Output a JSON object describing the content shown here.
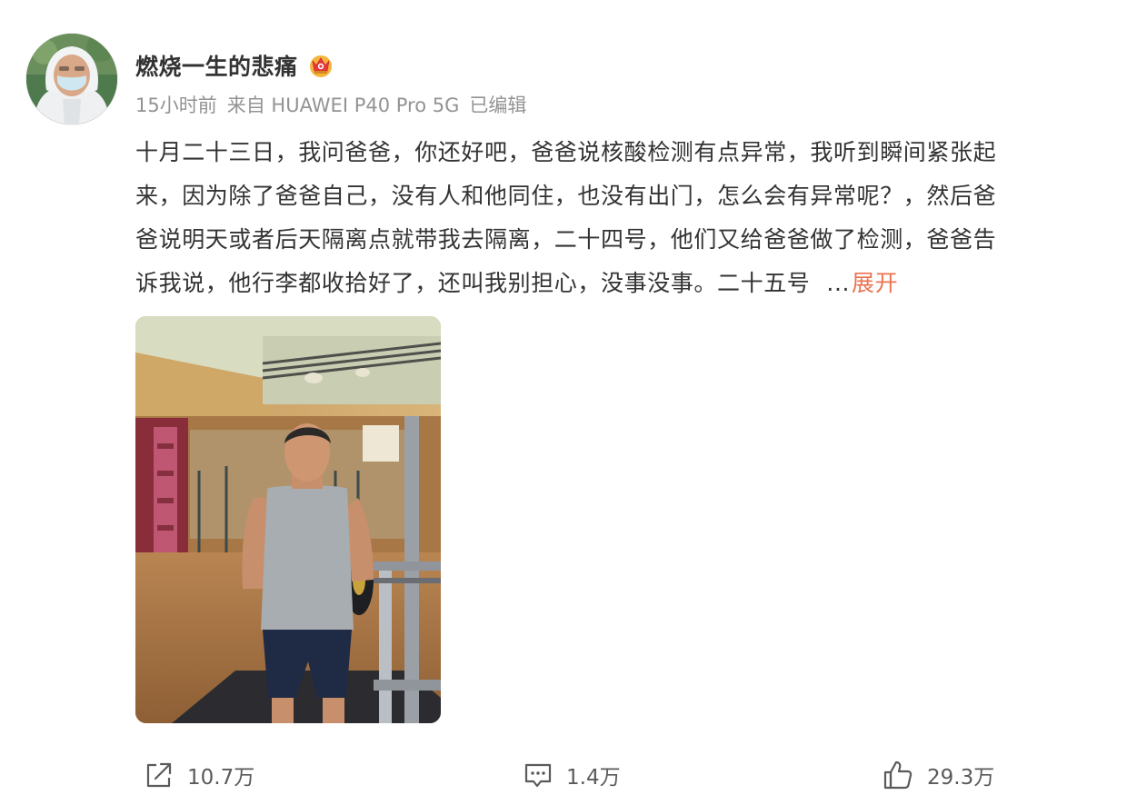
{
  "author": {
    "name": "燃烧一生的悲痛",
    "badge_icon": "vip-crown-badge-icon"
  },
  "meta": {
    "time": "15小时前",
    "source": "来自 HUAWEI P40 Pro 5G",
    "edited": "已编辑"
  },
  "content": {
    "lines": [
      "十月二十三日，我问爸爸，你还好吧，爸爸说核酸检测有点异常，我听到瞬间紧张起",
      "来，因为除了爸爸自己，没有人和他同住，也没有出门，怎么会有异常呢？，然后爸",
      "爸说明天或者后天隔离点就带我去隔离，二十四号，他们又给爸爸做了检测，爸爸告",
      "诉我说，他行李都收拾好了，还叫我别担心，没事没事。二十五号"
    ],
    "ellipsis": "...",
    "expand_label": "展开"
  },
  "actions": {
    "share": {
      "icon": "share-icon",
      "count": "10.7万"
    },
    "comment": {
      "icon": "comment-icon",
      "count": "1.4万"
    },
    "like": {
      "icon": "thumbs-up-icon",
      "count": "29.3万"
    }
  },
  "colors": {
    "text": "#333333",
    "meta": "#939393",
    "accent_link": "#eb7350",
    "action": "#5a5a5a"
  }
}
